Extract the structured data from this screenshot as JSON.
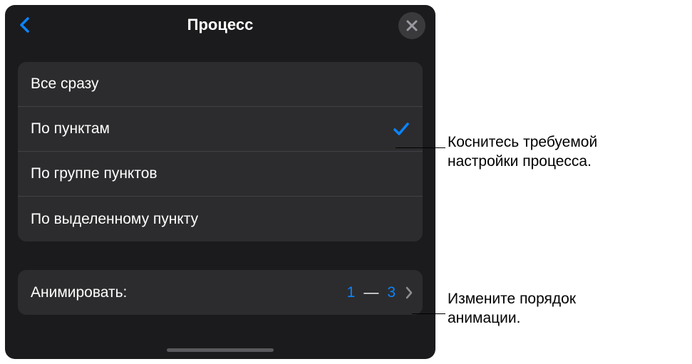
{
  "header": {
    "title": "Процесс"
  },
  "options": [
    {
      "label": "Все сразу",
      "selected": false
    },
    {
      "label": "По пунктам",
      "selected": true
    },
    {
      "label": "По группе пунктов",
      "selected": false
    },
    {
      "label": "По выделенному пункту",
      "selected": false
    }
  ],
  "animate": {
    "label": "Анимировать:",
    "from": "1",
    "to": "3"
  },
  "callouts": {
    "c1_line1": "Коснитесь требуемой",
    "c1_line2": "настройки процесса.",
    "c2_line1": "Измените порядок",
    "c2_line2": "анимации."
  }
}
